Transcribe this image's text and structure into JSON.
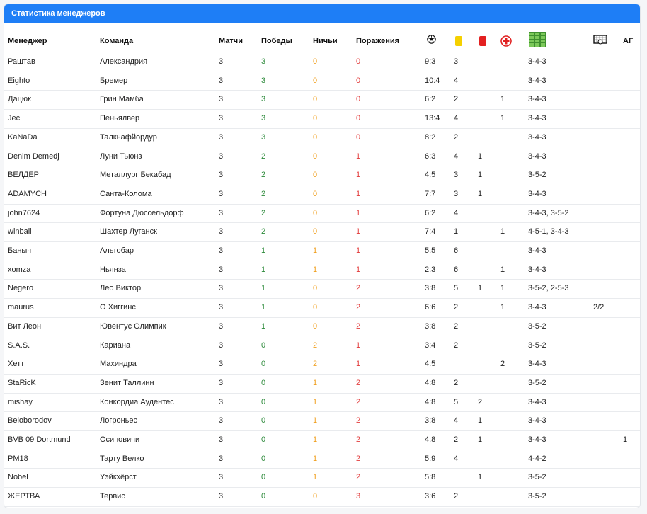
{
  "panel": {
    "title": "Статистика менеджеров"
  },
  "headers": {
    "manager": "Менеджер",
    "team": "Команда",
    "matches": "Матчи",
    "wins": "Победы",
    "draws": "Ничьи",
    "losses": "Поражения",
    "icons": [
      "ball-icon",
      "yellow-card-icon",
      "red-card-icon",
      "injury-icon",
      "formation-icon",
      "goalkeeper-icon"
    ],
    "ag": "АГ"
  },
  "colors": {
    "header_bg": "#1e7ef6",
    "win": "#2e8b3c",
    "draw": "#f0a020",
    "loss": "#e23c3c"
  },
  "rows": [
    {
      "manager": "Раштав",
      "team": "Александрия",
      "matches": "3",
      "wins": "3",
      "draws": "0",
      "losses": "0",
      "score": "9:3",
      "yellow": "3",
      "red": "",
      "injuries": "",
      "formation": "3-4-3",
      "gk": "",
      "ag": ""
    },
    {
      "manager": "Eighto",
      "team": "Бремер",
      "matches": "3",
      "wins": "3",
      "draws": "0",
      "losses": "0",
      "score": "10:4",
      "yellow": "4",
      "red": "",
      "injuries": "",
      "formation": "3-4-3",
      "gk": "",
      "ag": ""
    },
    {
      "manager": "Дацюк",
      "team": "Грин Мамба",
      "matches": "3",
      "wins": "3",
      "draws": "0",
      "losses": "0",
      "score": "6:2",
      "yellow": "2",
      "red": "",
      "injuries": "1",
      "formation": "3-4-3",
      "gk": "",
      "ag": ""
    },
    {
      "manager": "Jec",
      "team": "Пеньялвер",
      "matches": "3",
      "wins": "3",
      "draws": "0",
      "losses": "0",
      "score": "13:4",
      "yellow": "4",
      "red": "",
      "injuries": "1",
      "formation": "3-4-3",
      "gk": "",
      "ag": ""
    },
    {
      "manager": "KaNaDa",
      "team": "Талкнафйордур",
      "matches": "3",
      "wins": "3",
      "draws": "0",
      "losses": "0",
      "score": "8:2",
      "yellow": "2",
      "red": "",
      "injuries": "",
      "formation": "3-4-3",
      "gk": "",
      "ag": ""
    },
    {
      "manager": "Denim Demedj",
      "team": "Луни Тьюнз",
      "matches": "3",
      "wins": "2",
      "draws": "0",
      "losses": "1",
      "score": "6:3",
      "yellow": "4",
      "red": "1",
      "injuries": "",
      "formation": "3-4-3",
      "gk": "",
      "ag": ""
    },
    {
      "manager": "ВЕЛДЕР",
      "team": "Металлург Бекабад",
      "matches": "3",
      "wins": "2",
      "draws": "0",
      "losses": "1",
      "score": "4:5",
      "yellow": "3",
      "red": "1",
      "injuries": "",
      "formation": "3-5-2",
      "gk": "",
      "ag": ""
    },
    {
      "manager": "ADAMYCH",
      "team": "Санта-Колома",
      "matches": "3",
      "wins": "2",
      "draws": "0",
      "losses": "1",
      "score": "7:7",
      "yellow": "3",
      "red": "1",
      "injuries": "",
      "formation": "3-4-3",
      "gk": "",
      "ag": ""
    },
    {
      "manager": "john7624",
      "team": "Фортуна Дюссельдорф",
      "matches": "3",
      "wins": "2",
      "draws": "0",
      "losses": "1",
      "score": "6:2",
      "yellow": "4",
      "red": "",
      "injuries": "",
      "formation": "3-4-3, 3-5-2",
      "gk": "",
      "ag": ""
    },
    {
      "manager": "winball",
      "team": "Шахтер Луганск",
      "matches": "3",
      "wins": "2",
      "draws": "0",
      "losses": "1",
      "score": "7:4",
      "yellow": "1",
      "red": "",
      "injuries": "1",
      "formation": "4-5-1, 3-4-3",
      "gk": "",
      "ag": ""
    },
    {
      "manager": "Баныч",
      "team": "Альтобар",
      "matches": "3",
      "wins": "1",
      "draws": "1",
      "losses": "1",
      "score": "5:5",
      "yellow": "6",
      "red": "",
      "injuries": "",
      "formation": "3-4-3",
      "gk": "",
      "ag": ""
    },
    {
      "manager": "xomza",
      "team": "Ньянза",
      "matches": "3",
      "wins": "1",
      "draws": "1",
      "losses": "1",
      "score": "2:3",
      "yellow": "6",
      "red": "",
      "injuries": "1",
      "formation": "3-4-3",
      "gk": "",
      "ag": ""
    },
    {
      "manager": "Negero",
      "team": "Лео Виктор",
      "matches": "3",
      "wins": "1",
      "draws": "0",
      "losses": "2",
      "score": "3:8",
      "yellow": "5",
      "red": "1",
      "injuries": "1",
      "formation": "3-5-2, 2-5-3",
      "gk": "",
      "ag": ""
    },
    {
      "manager": "maurus",
      "team": "О Хиггинс",
      "matches": "3",
      "wins": "1",
      "draws": "0",
      "losses": "2",
      "score": "6:6",
      "yellow": "2",
      "red": "",
      "injuries": "1",
      "formation": "3-4-3",
      "gk": "2/2",
      "ag": ""
    },
    {
      "manager": "Вит Леон",
      "team": "Ювентус Олимпик",
      "matches": "3",
      "wins": "1",
      "draws": "0",
      "losses": "2",
      "score": "3:8",
      "yellow": "2",
      "red": "",
      "injuries": "",
      "formation": "3-5-2",
      "gk": "",
      "ag": ""
    },
    {
      "manager": "S.A.S.",
      "team": "Кариана",
      "matches": "3",
      "wins": "0",
      "draws": "2",
      "losses": "1",
      "score": "3:4",
      "yellow": "2",
      "red": "",
      "injuries": "",
      "formation": "3-5-2",
      "gk": "",
      "ag": ""
    },
    {
      "manager": "Хетт",
      "team": "Махиндра",
      "matches": "3",
      "wins": "0",
      "draws": "2",
      "losses": "1",
      "score": "4:5",
      "yellow": "",
      "red": "",
      "injuries": "2",
      "formation": "3-4-3",
      "gk": "",
      "ag": ""
    },
    {
      "manager": "StaRicK",
      "team": "Зенит Таллинн",
      "matches": "3",
      "wins": "0",
      "draws": "1",
      "losses": "2",
      "score": "4:8",
      "yellow": "2",
      "red": "",
      "injuries": "",
      "formation": "3-5-2",
      "gk": "",
      "ag": ""
    },
    {
      "manager": "mishay",
      "team": "Конкордиа Аудентес",
      "matches": "3",
      "wins": "0",
      "draws": "1",
      "losses": "2",
      "score": "4:8",
      "yellow": "5",
      "red": "2",
      "injuries": "",
      "formation": "3-4-3",
      "gk": "",
      "ag": ""
    },
    {
      "manager": "Beloborodov",
      "team": "Логроньес",
      "matches": "3",
      "wins": "0",
      "draws": "1",
      "losses": "2",
      "score": "3:8",
      "yellow": "4",
      "red": "1",
      "injuries": "",
      "formation": "3-4-3",
      "gk": "",
      "ag": ""
    },
    {
      "manager": "BVB 09 Dortmund",
      "team": "Осиповичи",
      "matches": "3",
      "wins": "0",
      "draws": "1",
      "losses": "2",
      "score": "4:8",
      "yellow": "2",
      "red": "1",
      "injuries": "",
      "formation": "3-4-3",
      "gk": "",
      "ag": "1"
    },
    {
      "manager": "PM18",
      "team": "Тарту Велко",
      "matches": "3",
      "wins": "0",
      "draws": "1",
      "losses": "2",
      "score": "5:9",
      "yellow": "4",
      "red": "",
      "injuries": "",
      "formation": "4-4-2",
      "gk": "",
      "ag": ""
    },
    {
      "manager": "Nobel",
      "team": "Уэйкхёрст",
      "matches": "3",
      "wins": "0",
      "draws": "1",
      "losses": "2",
      "score": "5:8",
      "yellow": "",
      "red": "1",
      "injuries": "",
      "formation": "3-5-2",
      "gk": "",
      "ag": ""
    },
    {
      "manager": "ЖЕРТВА",
      "team": "Тервис",
      "matches": "3",
      "wins": "0",
      "draws": "0",
      "losses": "3",
      "score": "3:6",
      "yellow": "2",
      "red": "",
      "injuries": "",
      "formation": "3-5-2",
      "gk": "",
      "ag": ""
    }
  ]
}
